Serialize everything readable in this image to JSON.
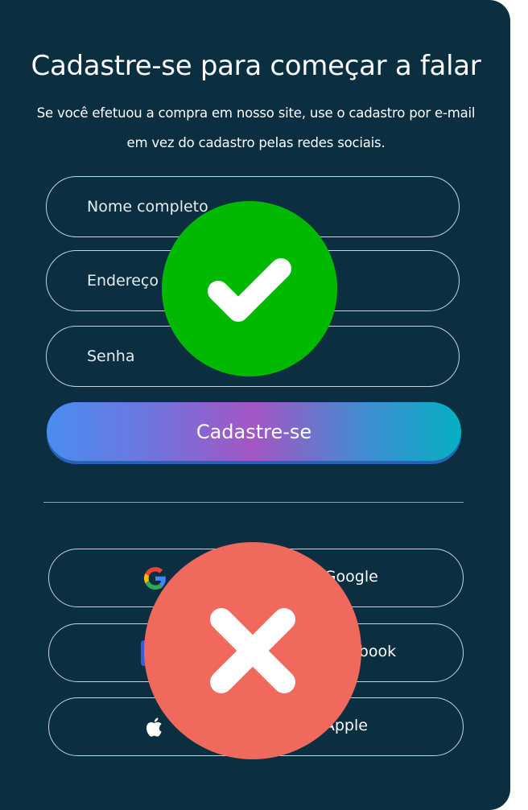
{
  "form": {
    "title": "Cadastre-se para começar a falar",
    "subtitle_line1": "Se você efetuou a compra em nosso site, use o cadastro por e-mail",
    "subtitle_line2": "em vez do cadastro pelas redes sociais.",
    "fields": [
      {
        "placeholder": "Nome completo",
        "value": ""
      },
      {
        "placeholder": "Endereço de e-mail",
        "value": ""
      },
      {
        "placeholder": "Senha",
        "value": ""
      }
    ],
    "submit_label": "Cadastre-se"
  },
  "social": {
    "buttons": [
      {
        "label": "Cadastre-se com o Google",
        "icon": "google-icon"
      },
      {
        "label": "Cadastre-se com o Facebook",
        "icon": "facebook-icon"
      },
      {
        "label": "Cadastre-se com a Apple",
        "icon": "apple-icon"
      }
    ]
  },
  "overlays": {
    "approved": {
      "icon": "checkmark-icon",
      "color": "#00b900"
    },
    "rejected": {
      "icon": "cross-icon",
      "color": "#ef6a5d"
    }
  },
  "colors": {
    "background": "#0b2e40",
    "gradient": [
      "#4a8df0",
      "#a356c4",
      "#05b0c2"
    ]
  }
}
